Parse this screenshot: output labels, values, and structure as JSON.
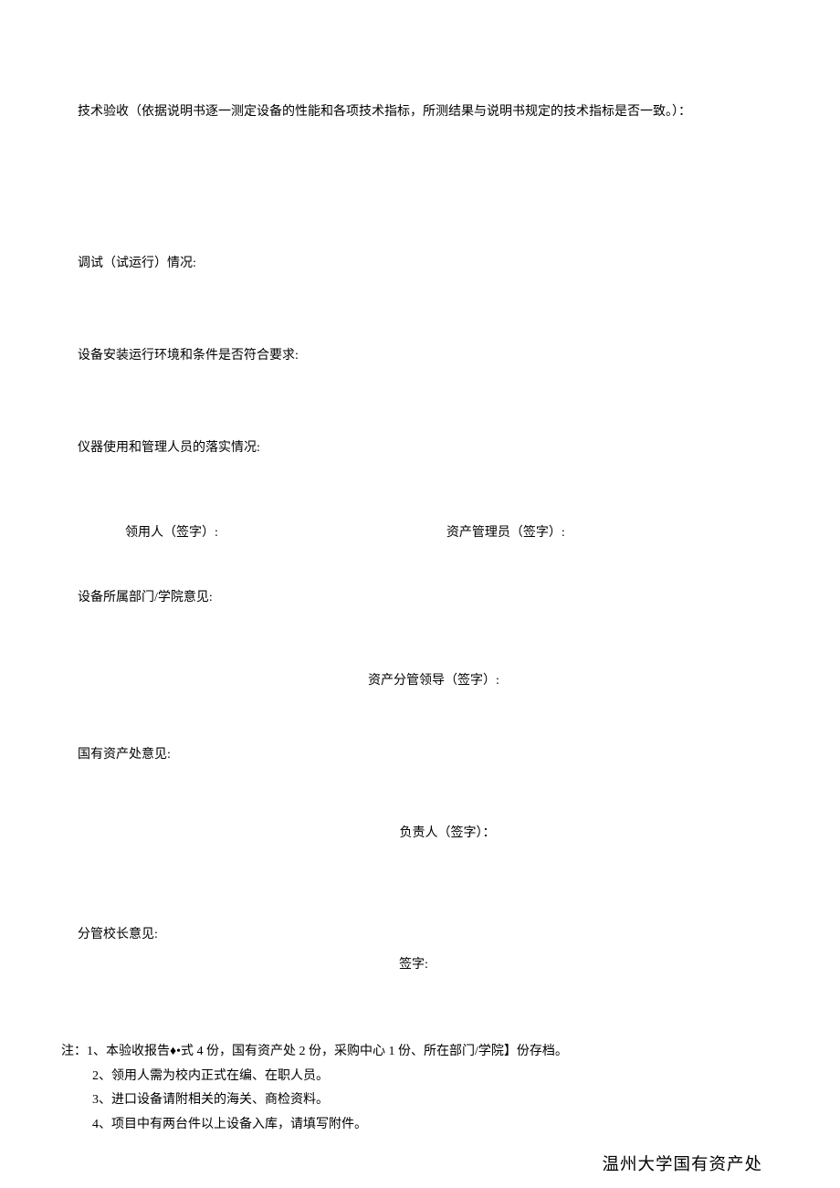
{
  "section1": "技术验收（依据说明书逐一测定设备的性能和各项技术指标，所测结果与说明书规定的技术指标是否一致。）：",
  "section2": "调试（试运行）情况:",
  "section3": "设备安装运行环境和条件是否符合要求:",
  "section4": "仪器使用和管理人员的落实情况:",
  "signRow": {
    "left": "领用人（签字）:",
    "right": "资产管理员（签字）:"
  },
  "section5": "设备所属部门/学院意见:",
  "centeredSign1": "资产分管领导（签字）:",
  "section6": "国有资产处意见:",
  "centeredSign2": "负责人（签字）：",
  "section7": "分管校长意见:",
  "sign7": "签字:",
  "notes": {
    "line1": "注：1、本验收报告♦•式 4 份，国有资产处 2 份，采购中心 1 份、所在部门/学院】份存档。",
    "line2": "2、领用人需为校内正式在编、在职人员。",
    "line3": "3、进口设备请附相关的海关、商检资料。",
    "line4": "4、项目中有两台件以上设备入库，请填写附件。"
  },
  "footerOrg": "温州大学国有资产处"
}
